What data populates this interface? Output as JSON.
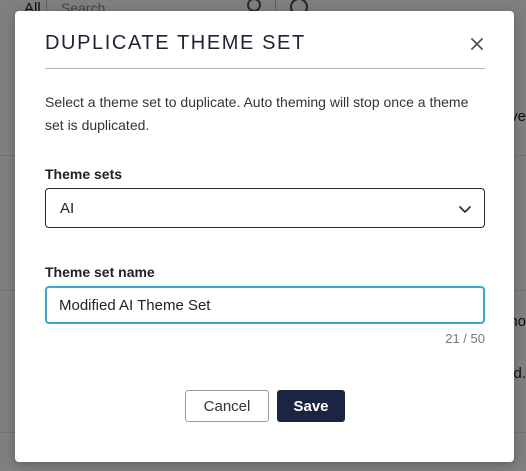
{
  "background": {
    "nav_label": "All",
    "search_placeholder": "Search",
    "edge_text": [
      "ve",
      "no",
      "d."
    ]
  },
  "dialog": {
    "title": "DUPLICATE THEME SET",
    "description": "Select a theme set to duplicate. Auto theming will stop once a theme set is duplicated.",
    "theme_sets": {
      "label": "Theme sets",
      "selected": "AI"
    },
    "theme_set_name": {
      "label": "Theme set name",
      "value": "Modified AI Theme Set",
      "char_count": "21 / 50"
    },
    "buttons": {
      "cancel": "Cancel",
      "save": "Save"
    }
  },
  "colors": {
    "title": "#1e2235",
    "focus_border": "#3fa7c9",
    "primary_button": "#1b2542",
    "overlay": "rgba(0,0,0,0.5)"
  },
  "icons": {
    "close": "close-icon",
    "dropdown": "chevron-down-icon",
    "search": "search-icon"
  }
}
